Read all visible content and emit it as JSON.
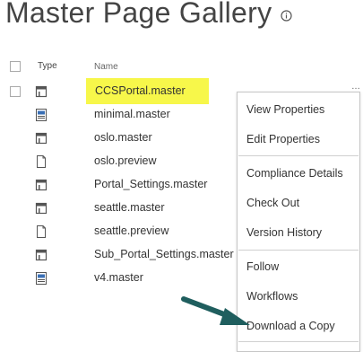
{
  "page": {
    "title": "Master Page Gallery"
  },
  "list": {
    "headers": {
      "type": "Type",
      "name": "Name"
    },
    "rows": [
      {
        "name": "CCSPortal.master",
        "icon": "master-page-icon",
        "highlighted": true
      },
      {
        "name": "minimal.master",
        "icon": "document-lines-icon"
      },
      {
        "name": "oslo.master",
        "icon": "master-page-icon"
      },
      {
        "name": "oslo.preview",
        "icon": "blank-document-icon"
      },
      {
        "name": "Portal_Settings.master",
        "icon": "master-page-icon"
      },
      {
        "name": "seattle.master",
        "icon": "master-page-icon"
      },
      {
        "name": "seattle.preview",
        "icon": "blank-document-icon"
      },
      {
        "name": "Sub_Portal_Settings.master",
        "icon": "master-page-icon"
      },
      {
        "name": "v4.master",
        "icon": "document-lines-icon"
      }
    ]
  },
  "context_menu": {
    "items": [
      "View Properties",
      "Edit Properties",
      "Compliance Details",
      "Check Out",
      "Version History",
      "Follow",
      "Workflows",
      "Download a Copy"
    ]
  },
  "colors": {
    "highlight": "#f7f74a",
    "arrow": "#1f5e5e",
    "text": "#333333"
  }
}
